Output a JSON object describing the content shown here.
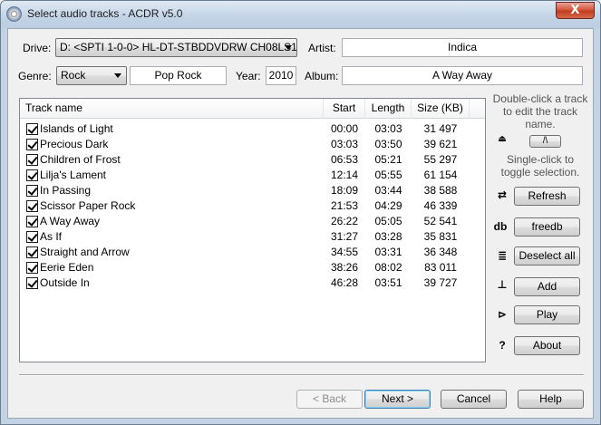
{
  "window": {
    "title": "Select audio tracks - ACDR v5.0",
    "close_label": "X"
  },
  "form": {
    "drive_label": "Drive:",
    "drive_value": "D: <SPTI 1-0-0> HL-DT-STBDDVDRW CH08LS10",
    "artist_label": "Artist:",
    "artist_value": "Indica",
    "genre_label": "Genre:",
    "genre_value": "Rock",
    "genre_text": "Pop Rock",
    "year_label": "Year:",
    "year_value": "2010",
    "album_label": "Album:",
    "album_value": "A Way Away"
  },
  "tracks": {
    "columns": [
      "Track name",
      "Start",
      "Length",
      "Size (KB)"
    ],
    "rows": [
      {
        "name": "Islands of Light",
        "start": "00:00",
        "length": "03:03",
        "size": "31 497",
        "checked": true
      },
      {
        "name": "Precious Dark",
        "start": "03:03",
        "length": "03:50",
        "size": "39 621",
        "checked": true
      },
      {
        "name": "Children of Frost",
        "start": "06:53",
        "length": "05:21",
        "size": "55 297",
        "checked": true
      },
      {
        "name": "Lilja's Lament",
        "start": "12:14",
        "length": "05:55",
        "size": "61 154",
        "checked": true
      },
      {
        "name": "In Passing",
        "start": "18:09",
        "length": "03:44",
        "size": "38 588",
        "checked": true
      },
      {
        "name": "Scissor Paper Rock",
        "start": "21:53",
        "length": "04:29",
        "size": "46 339",
        "checked": true
      },
      {
        "name": "A Way Away",
        "start": "26:22",
        "length": "05:05",
        "size": "52 541",
        "checked": true
      },
      {
        "name": "As If",
        "start": "31:27",
        "length": "03:28",
        "size": "35 831",
        "checked": true
      },
      {
        "name": "Straight and Arrow",
        "start": "34:55",
        "length": "03:31",
        "size": "36 348",
        "checked": true
      },
      {
        "name": "Eerie Eden",
        "start": "38:26",
        "length": "08:02",
        "size": "83 011",
        "checked": true
      },
      {
        "name": "Outside In",
        "start": "46:28",
        "length": "03:51",
        "size": "39 727",
        "checked": true
      }
    ]
  },
  "side": {
    "hint_edit": "Double-click a track to edit the track name.",
    "case_button": "/\\",
    "hint_toggle": "Single-click to toggle selection.",
    "refresh": "Refresh",
    "freedb": "freedb",
    "freedb_icon_text": "db",
    "deselect_all": "Deselect all",
    "add": "Add",
    "play": "Play",
    "about": "About",
    "about_icon_text": "?"
  },
  "footer": {
    "back": "< Back",
    "next": "Next >",
    "cancel": "Cancel",
    "help": "Help"
  }
}
